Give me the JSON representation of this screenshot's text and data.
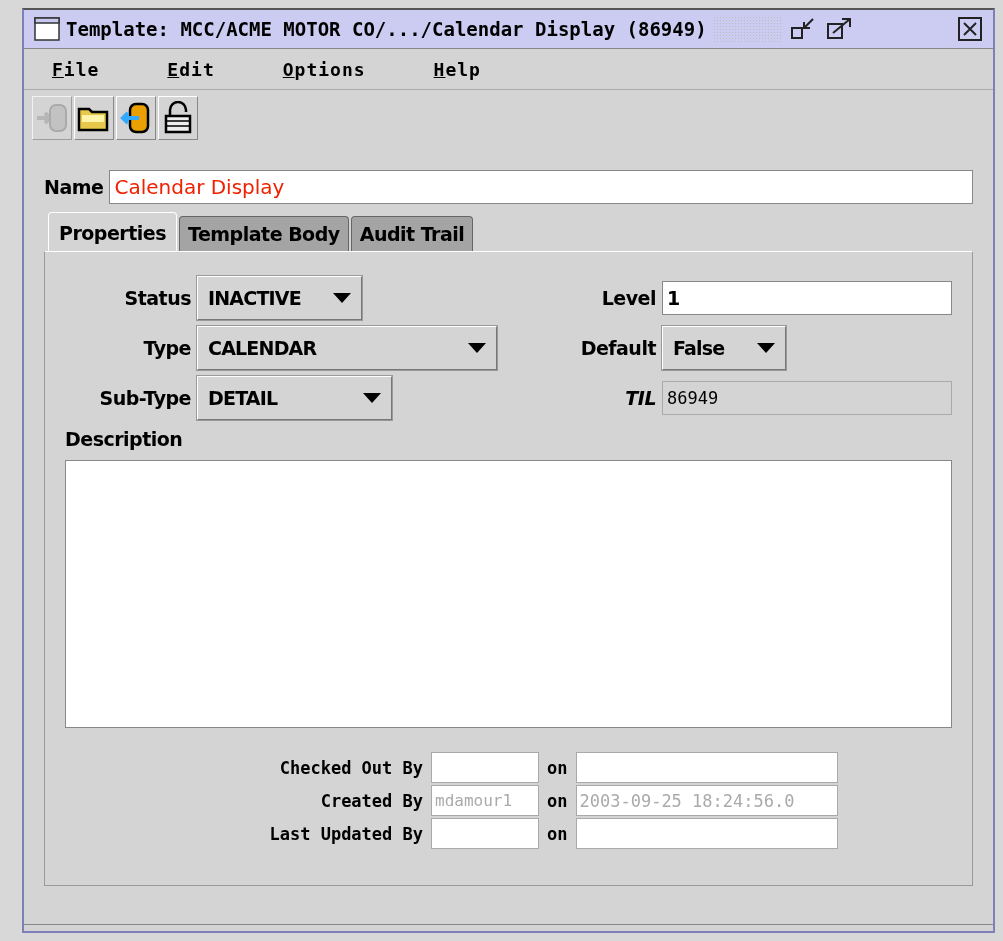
{
  "window": {
    "title": "Template: MCC/ACME MOTOR CO/.../Calendar Display (86949)"
  },
  "menu": [
    {
      "label": "File"
    },
    {
      "label": "Edit"
    },
    {
      "label": "Options"
    },
    {
      "label": "Help"
    }
  ],
  "toolbar": [
    {
      "kind": "checkin",
      "disabled": true
    },
    {
      "kind": "open",
      "disabled": false
    },
    {
      "kind": "checkout",
      "disabled": false
    },
    {
      "kind": "unlock",
      "disabled": false
    }
  ],
  "name": {
    "label": "Name",
    "value": "Calendar Display"
  },
  "tabs": [
    {
      "label": "Properties",
      "selected": true
    },
    {
      "label": "Template Body",
      "selected": false
    },
    {
      "label": "Audit Trail",
      "selected": false
    }
  ],
  "left_fields": [
    {
      "label": "Status",
      "value": "INACTIVE"
    },
    {
      "label": "Type",
      "value": "CALENDAR"
    },
    {
      "label": "Sub-Type",
      "value": "DETAIL"
    }
  ],
  "right_fields": [
    {
      "kind": "input",
      "label": "Level",
      "value": "1"
    },
    {
      "kind": "select",
      "label": "Default",
      "value": "False"
    },
    {
      "kind": "readonly",
      "label": "TIL",
      "value": "86949"
    }
  ],
  "description": {
    "label": "Description"
  },
  "audit": [
    {
      "label": "Checked Out By",
      "on": "on"
    },
    {
      "label": "Created By",
      "user": "mdamour1",
      "on": "on",
      "date": "2003-09-25 18:24:56.0"
    },
    {
      "label": "Last Updated By",
      "on": "on"
    }
  ]
}
